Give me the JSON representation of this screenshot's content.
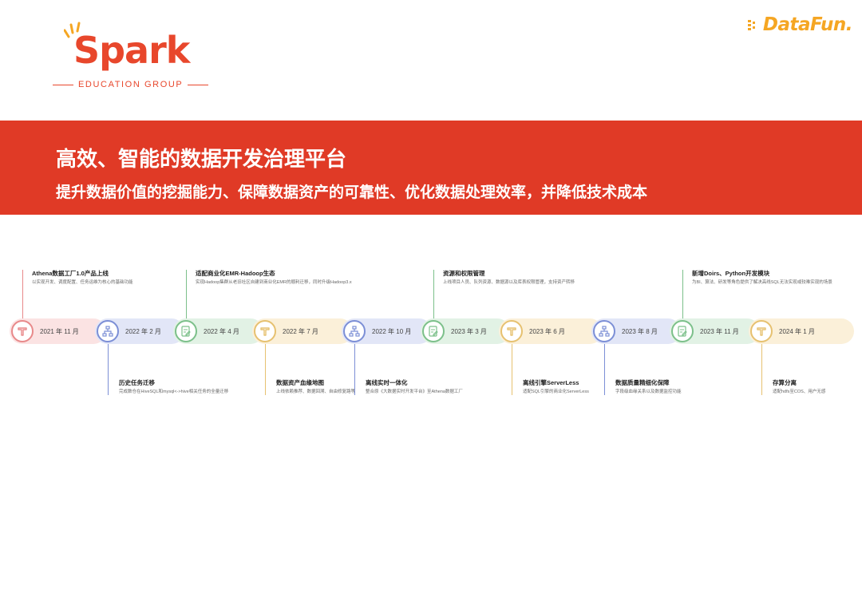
{
  "header": {
    "spark_word": "Spark",
    "spark_tagline": "EDUCATION GROUP",
    "datafun_word": "DataFun."
  },
  "banner": {
    "title": "高效、智能的数据开发治理平台",
    "subtitle": "提升数据价值的挖掘能力、保障数据资产的可靠性、优化数据处理效率，并降低技术成本"
  },
  "colors": {
    "brand_red": "#e03a26",
    "spark_orange": "#e8472c",
    "datafun_yellow": "#f5a623",
    "red": "#e8898a",
    "blue": "#7c8fd6",
    "green": "#7cc08a",
    "yellow": "#e6c170"
  },
  "timeline": {
    "nodes": [
      {
        "date": "2021 年 11 月",
        "icon": "t-tool-icon",
        "color": "red"
      },
      {
        "date": "2022 年 2 月",
        "icon": "hierarchy-icon",
        "color": "blue"
      },
      {
        "date": "2022 年 4 月",
        "icon": "edit-doc-icon",
        "color": "green"
      },
      {
        "date": "2022 年 7 月",
        "icon": "t-tool-icon",
        "color": "yellow"
      },
      {
        "date": "2022 年 10 月",
        "icon": "hierarchy-icon",
        "color": "blue"
      },
      {
        "date": "2023 年 3 月",
        "icon": "edit-doc-icon",
        "color": "green"
      },
      {
        "date": "2023 年 6 月",
        "icon": "t-tool-icon",
        "color": "yellow"
      },
      {
        "date": "2023 年 8 月",
        "icon": "hierarchy-icon",
        "color": "blue"
      },
      {
        "date": "2023 年 11 月",
        "icon": "edit-doc-icon",
        "color": "green"
      },
      {
        "date": "2024 年 1 月",
        "icon": "t-tool-icon",
        "color": "yellow"
      }
    ],
    "top_events": [
      {
        "title": "Athena数据工厂1.0产品上线",
        "desc": "以实现开发、调度配置、任务运维为核心的基础功能",
        "color": "red"
      },
      {
        "title": "适配商业化EMR-Hadoop生态",
        "desc": "实现Hadoop集群从老旧社区自建到商业化EMR的顺利迁移，同时升级Hadoop3.x",
        "color": "green"
      },
      {
        "title": "资源和权限管理",
        "desc": "上线项目人员、队列资源、数据源以及库表权限管理，支持资产转移",
        "color": "green"
      },
      {
        "title": "新增Doirs、Python开发模块",
        "desc": "为BI、算法、研发等角色提供了解决高线SQL无法实现或较难实现的场景",
        "color": "green"
      }
    ],
    "bottom_events": [
      {
        "title": "历史任务迁移",
        "desc": "完成数仓在HiveSQL和mysql<->hive相关任务的全量迁移",
        "color": "blue"
      },
      {
        "title": "数据资产血缘地图",
        "desc": "上线依赖推荐、数据回溯、自由修复路等",
        "color": "yellow"
      },
      {
        "title": "离线实时一体化",
        "desc": "整合原《大数据实时开发平台》至Athena数据工厂",
        "color": "blue"
      },
      {
        "title": "离线引擎ServerLess",
        "desc": "适配SQL引擎的商业化ServerLess",
        "color": "yellow"
      },
      {
        "title": "数据质量精细化保障",
        "desc": "字段级血缘关系以及数据监控功能",
        "color": "blue"
      },
      {
        "title": "存算分离",
        "desc": "适配hdfs至COS、用户无感",
        "color": "yellow"
      }
    ]
  }
}
